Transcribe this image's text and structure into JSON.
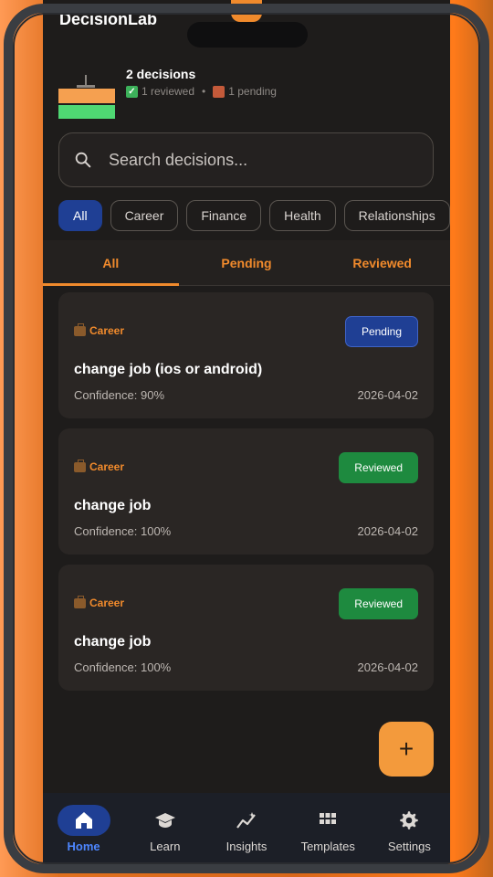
{
  "app": {
    "title": "DecisionLab"
  },
  "summary": {
    "count": "2 decisions",
    "reviewed": "1 reviewed",
    "separator": "•",
    "pending": "1 pending"
  },
  "search": {
    "placeholder": "Search decisions..."
  },
  "filters": [
    "All",
    "Career",
    "Finance",
    "Health",
    "Relationships"
  ],
  "active_filter": "All",
  "tabs": [
    "All",
    "Pending",
    "Reviewed"
  ],
  "active_tab": "All",
  "decisions": [
    {
      "category": "Career",
      "status": "Pending",
      "title": "change job (ios or android)",
      "confidence": "Confidence: 90%",
      "date": "2026-04-02"
    },
    {
      "category": "Career",
      "status": "Reviewed",
      "title": "change job",
      "confidence": "Confidence: 100%",
      "date": "2026-04-02"
    },
    {
      "category": "Career",
      "status": "Reviewed",
      "title": "change job",
      "confidence": "Confidence: 100%",
      "date": "2026-04-02"
    }
  ],
  "fab": {
    "label": "+"
  },
  "nav": [
    "Home",
    "Learn",
    "Insights",
    "Templates",
    "Settings"
  ],
  "active_nav": "Home",
  "colors": {
    "accent": "#f08a2c",
    "primary": "#1f3f94",
    "reviewed": "#1e8a3f",
    "nav_active": "#4d86ff"
  },
  "icons": {
    "search": "search-icon",
    "fab": "plus-icon",
    "nav": [
      "home-icon",
      "graduation-cap-icon",
      "trend-chart-icon",
      "grid-icon",
      "gear-icon"
    ],
    "category": "briefcase-icon"
  }
}
